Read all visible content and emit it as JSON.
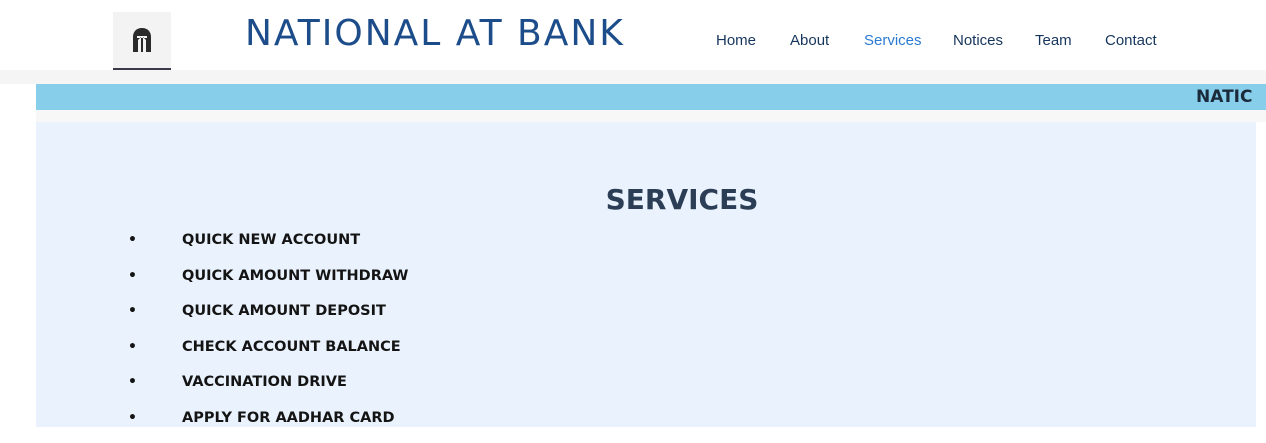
{
  "brand": {
    "logo_icon": "spartan-helmet-icon",
    "name": "NATIONAL AT BANK"
  },
  "nav": {
    "items": [
      {
        "label": "Home",
        "active": false
      },
      {
        "label": "About",
        "active": false
      },
      {
        "label": "Services",
        "active": true
      },
      {
        "label": "Notices",
        "active": false
      },
      {
        "label": "Team",
        "active": false
      },
      {
        "label": "Contact",
        "active": false
      }
    ]
  },
  "ticker": {
    "text": "NATIC"
  },
  "services": {
    "title": "SERVICES",
    "items": [
      "QUICK NEW ACCOUNT",
      "QUICK AMOUNT WITHDRAW",
      "QUICK AMOUNT DEPOSIT",
      "CHECK ACCOUNT BALANCE",
      "VACCINATION DRIVE",
      "APPLY FOR AADHAR CARD"
    ]
  },
  "colors": {
    "brand_text": "#1c4d8a",
    "nav_text": "#16355c",
    "nav_active": "#2a7bd1",
    "ticker_bg": "#87ceeb",
    "content_bg": "#eaf3fd",
    "title_text": "#2b3e55"
  }
}
